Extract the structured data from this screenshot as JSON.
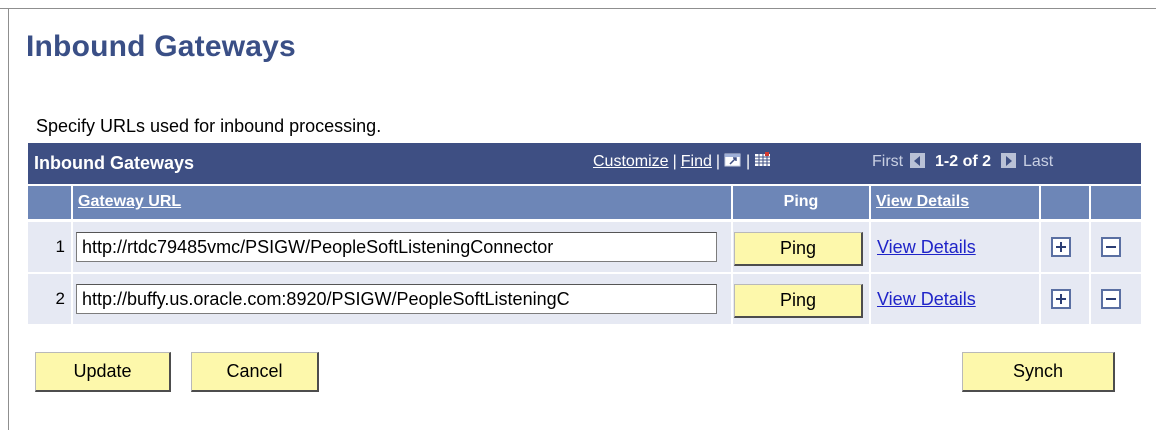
{
  "page": {
    "title": "Inbound Gateways",
    "instructions": "Specify URLs used for inbound processing."
  },
  "grid": {
    "title": "Inbound Gateways",
    "toolbar": {
      "customize": "Customize",
      "find": "Find",
      "separator": "|",
      "view_all_icon": "new-window-icon",
      "download_icon": "download-to-spreadsheet-icon"
    },
    "pager": {
      "first": "First",
      "count": "1-2 of 2",
      "last": "Last"
    },
    "columns": {
      "gateway_url": "Gateway URL",
      "ping": "Ping",
      "view_details": "View Details"
    },
    "rows": [
      {
        "num": "1",
        "url": "http://rtdc79485vmc/PSIGW/PeopleSoftListeningConnector",
        "ping_label": "Ping",
        "details_label": "View Details"
      },
      {
        "num": "2",
        "url": "http://buffy.us.oracle.com:8920/PSIGW/PeopleSoftListeningC",
        "ping_label": "Ping",
        "details_label": "View Details"
      }
    ]
  },
  "buttons": {
    "update": "Update",
    "cancel": "Cancel",
    "synch": "Synch"
  },
  "colors": {
    "header_bg": "#3e4f83",
    "column_header_bg": "#6d86b7",
    "row_bg": "#e6e9f3",
    "button_bg": "#fdf8ab",
    "title_color": "#3a4f86",
    "link_color": "#1f24c8"
  }
}
